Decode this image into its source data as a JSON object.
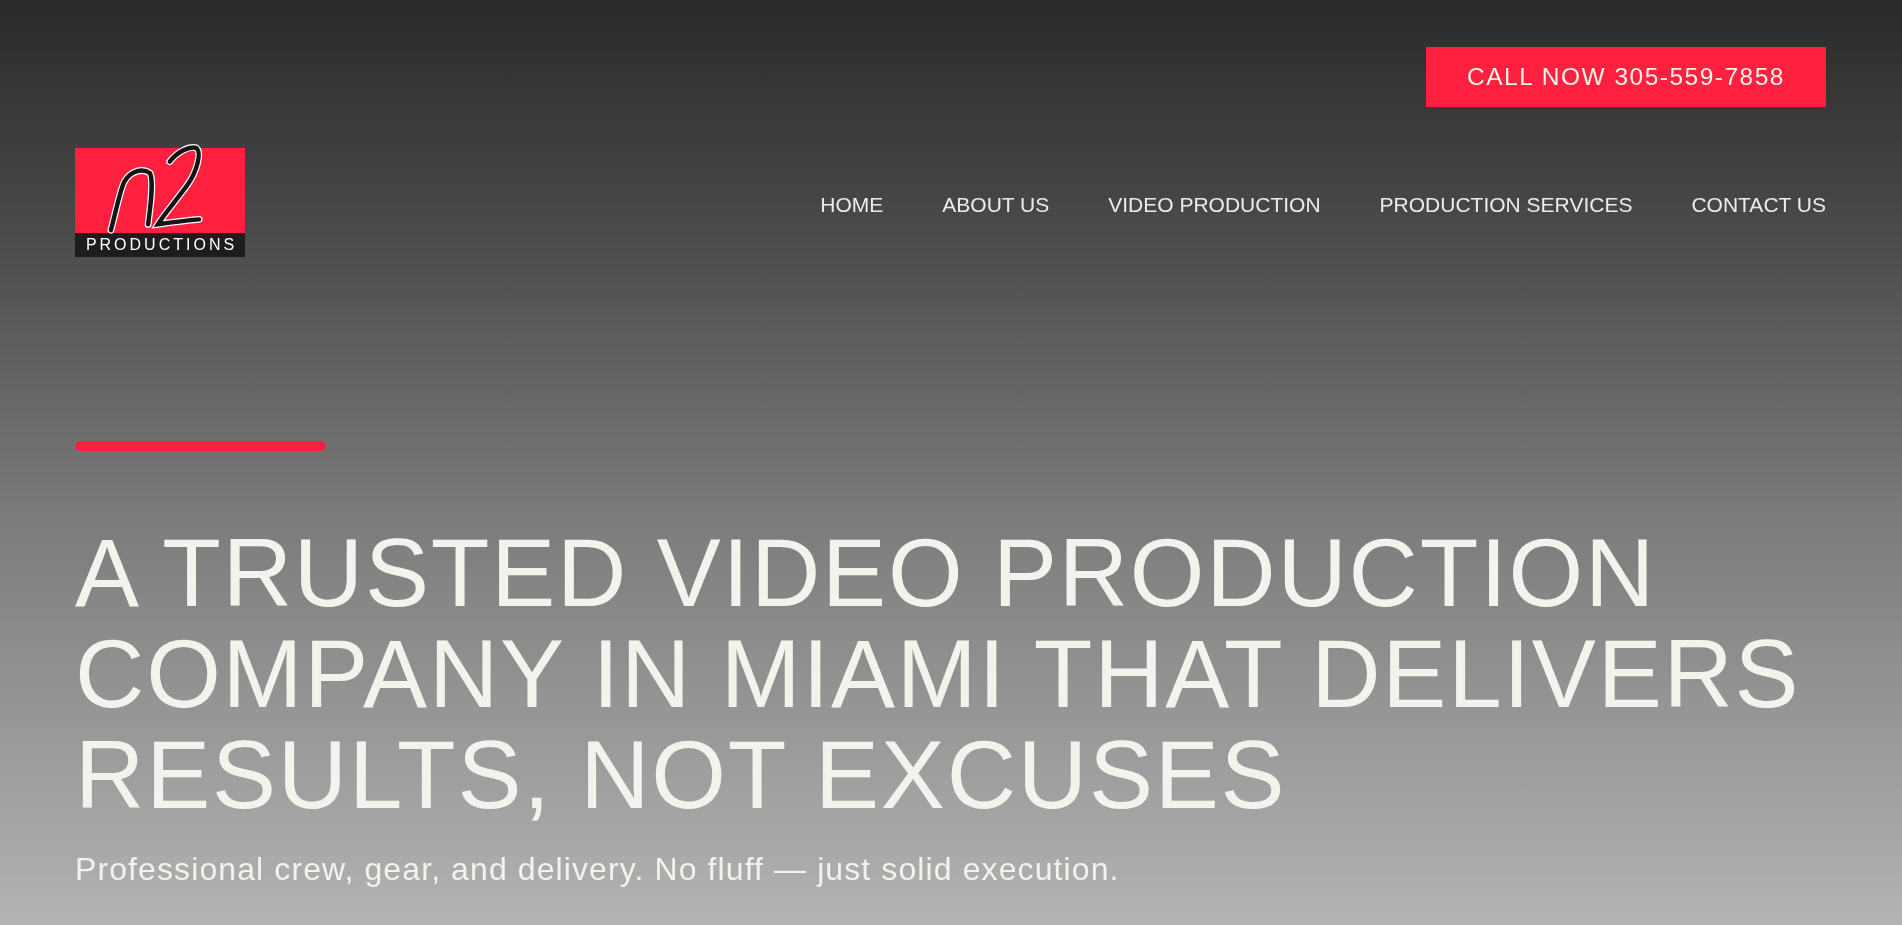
{
  "header": {
    "call_button": "CALL NOW 305-559-7858",
    "logo": {
      "text": "PRODUCTIONS"
    },
    "nav": [
      {
        "label": "HOME"
      },
      {
        "label": "ABOUT US"
      },
      {
        "label": "VIDEO PRODUCTION"
      },
      {
        "label": "PRODUCTION SERVICES"
      },
      {
        "label": "CONTACT US"
      }
    ]
  },
  "hero": {
    "headline": "A TRUSTED VIDEO PRODUCTION COMPANY IN MIAMI THAT DELIVERS RESULTS, NOT EXCUSES",
    "subtitle": "Professional crew, gear, and delivery. No fluff — just solid execution."
  }
}
